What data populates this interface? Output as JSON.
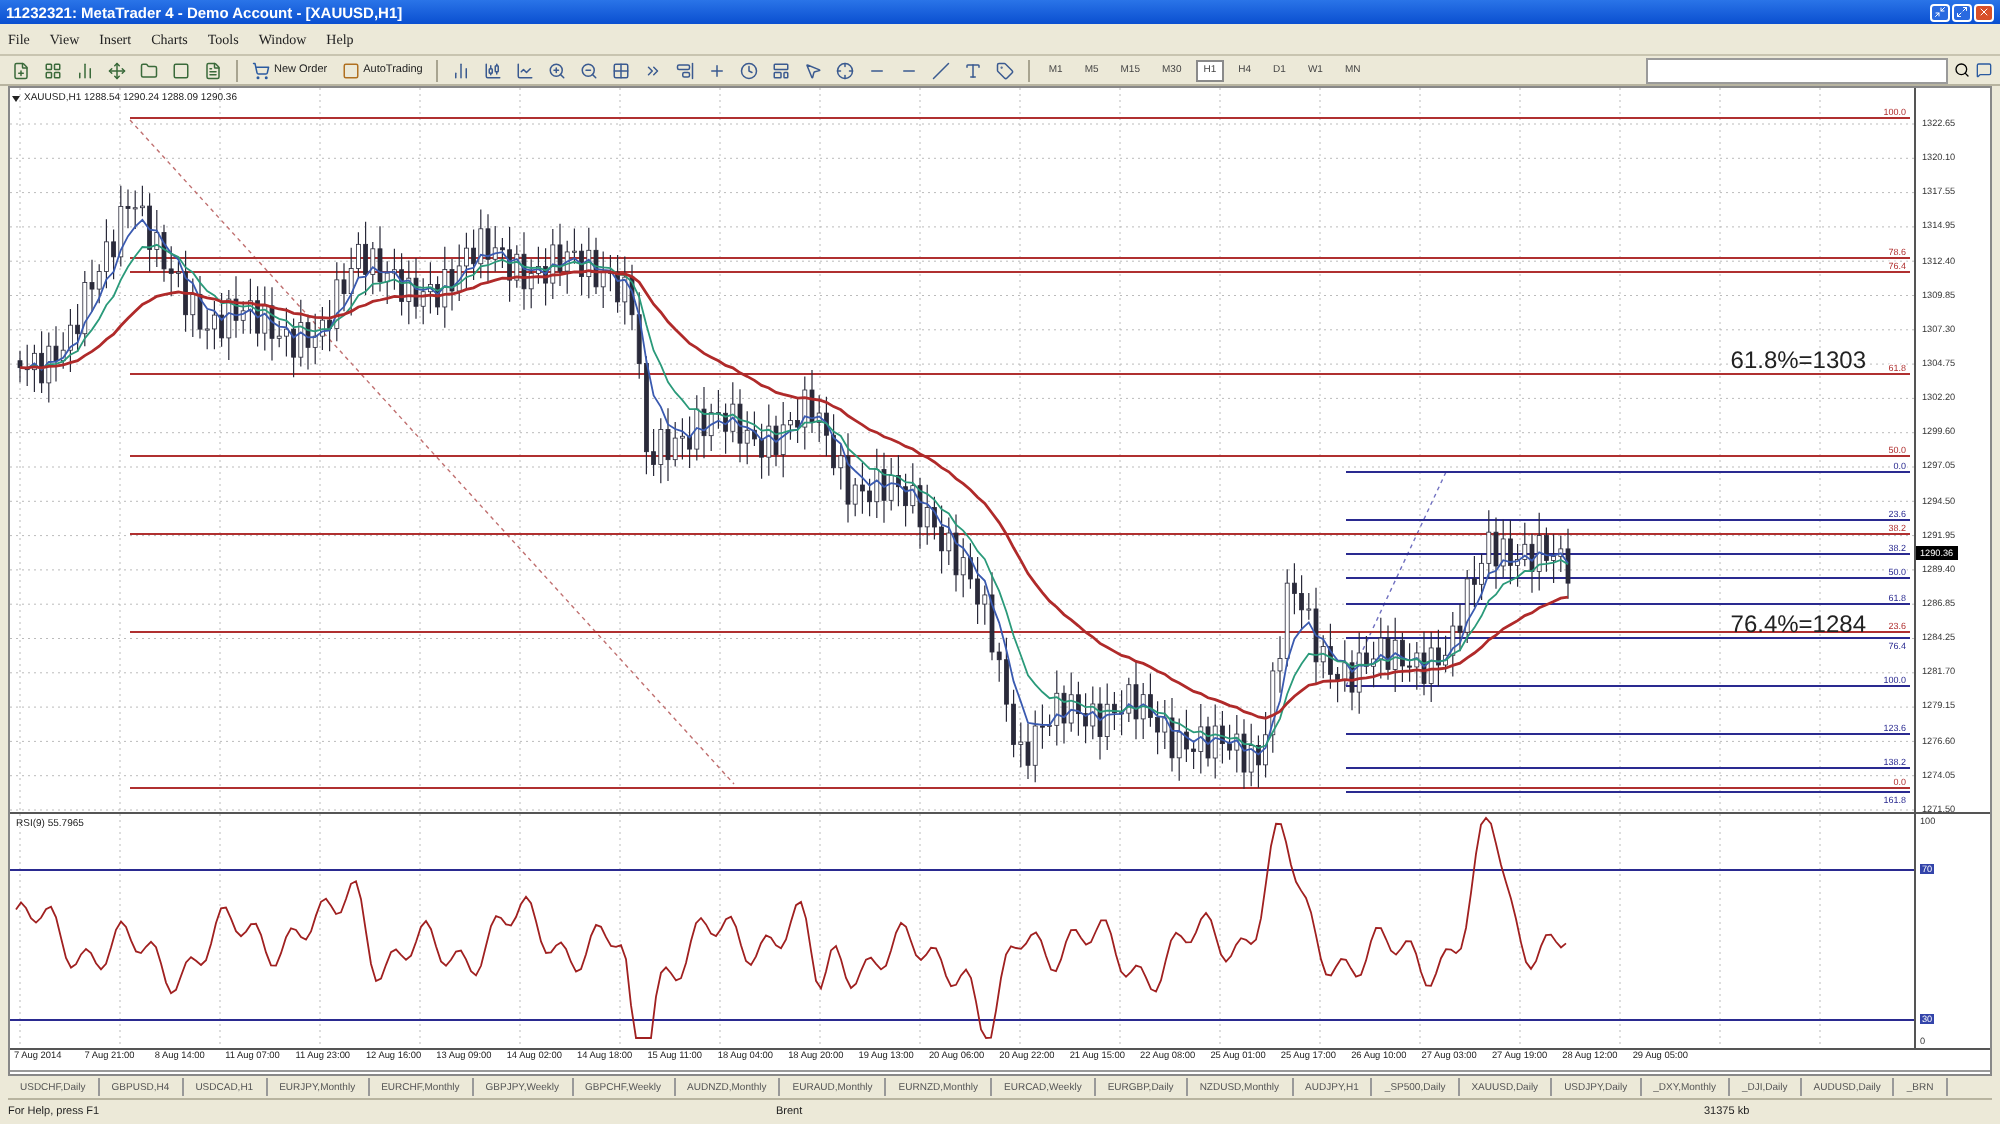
{
  "window": {
    "title": "11232321: MetaTrader 4 - Demo Account - [XAUUSD,H1]"
  },
  "menu": [
    "File",
    "View",
    "Insert",
    "Charts",
    "Tools",
    "Window",
    "Help"
  ],
  "toolbar": {
    "new_order": "New Order",
    "auto_trading": "AutoTrading",
    "timeframes": [
      {
        "label": "M1",
        "selected": false
      },
      {
        "label": "M5",
        "selected": false
      },
      {
        "label": "M15",
        "selected": false
      },
      {
        "label": "M30",
        "selected": false
      },
      {
        "label": "H1",
        "selected": true
      },
      {
        "label": "H4",
        "selected": false
      },
      {
        "label": "D1",
        "selected": false
      },
      {
        "label": "W1",
        "selected": false
      },
      {
        "label": "MN",
        "selected": false
      }
    ]
  },
  "chart": {
    "header": "XAUUSD,H1  1288.54 1290.24 1288.09 1290.36",
    "price_axis": [
      "1322.65",
      "1320.10",
      "1317.55",
      "1314.95",
      "1312.40",
      "1309.85",
      "1307.30",
      "1304.75",
      "1302.20",
      "1299.60",
      "1297.05",
      "1294.50",
      "1291.95",
      "1289.40",
      "1286.85",
      "1284.25",
      "1281.70",
      "1279.15",
      "1276.60",
      "1274.05",
      "1271.50"
    ],
    "current_price": "1290.36",
    "fib_red": [
      "100.0",
      "78.6",
      "76.4",
      "61.8",
      "50.0",
      "38.2",
      "23.6",
      "0.0"
    ],
    "fib_blue": [
      "0.0",
      "23.6",
      "38.2",
      "50.0",
      "61.8",
      "76.4",
      "100.0",
      "123.6",
      "138.2",
      "161.8"
    ],
    "annotations": [
      "61.8%=1303",
      "76.4%=1284"
    ],
    "rsi": {
      "label": "RSI(9) 55.7965",
      "axis": [
        "100",
        "70",
        "30",
        "0"
      ]
    },
    "time_axis": [
      "7 Aug 2014",
      "7 Aug 21:00",
      "8 Aug 14:00",
      "11 Aug 07:00",
      "11 Aug 23:00",
      "12 Aug 16:00",
      "13 Aug 09:00",
      "14 Aug 02:00",
      "14 Aug 18:00",
      "15 Aug 11:00",
      "18 Aug 04:00",
      "18 Aug 20:00",
      "19 Aug 13:00",
      "20 Aug 06:00",
      "20 Aug 22:00",
      "21 Aug 15:00",
      "22 Aug 08:00",
      "25 Aug 01:00",
      "25 Aug 17:00",
      "26 Aug 10:00",
      "27 Aug 03:00",
      "27 Aug 19:00",
      "28 Aug 12:00",
      "29 Aug 05:00"
    ]
  },
  "symbol_tabs": [
    "USDCHF,Daily",
    "GBPUSD,H4",
    "USDCAD,H1",
    "EURJPY,Monthly",
    "EURCHF,Monthly",
    "GBPJPY,Weekly",
    "GBPCHF,Weekly",
    "AUDNZD,Monthly",
    "EURAUD,Monthly",
    "EURNZD,Monthly",
    "EURCAD,Weekly",
    "EURGBP,Daily",
    "NZDUSD,Monthly",
    "AUDJPY,H1",
    "_SP500,Daily",
    "XAUUSD,Daily",
    "USDJPY,Daily",
    "_DXY,Monthly",
    "_DJI,Daily",
    "AUDUSD,Daily",
    "_BRN"
  ],
  "status_bar": [
    "For Help, press F1",
    "Brent",
    "31375 kb"
  ]
}
